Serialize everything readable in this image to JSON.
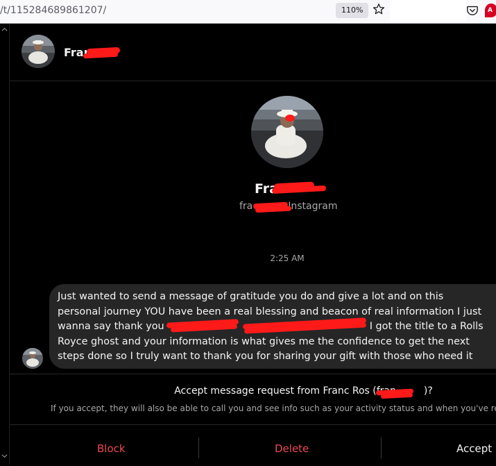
{
  "browser": {
    "url": "/t/115284689861207/",
    "zoom": "110%",
    "icons": [
      "star-icon",
      "pocket-icon",
      "extension-icon"
    ]
  },
  "header": {
    "name": "Fran"
  },
  "profile": {
    "name": "Fra",
    "handle_prefix": "fra",
    "handle_suffix": "Instagram"
  },
  "thread": {
    "timestamp": "2:25 AM",
    "message": {
      "line1": "Just wanted to send a message of gratitude you do and give a lot and on this",
      "line2": "personal journey YOU have been a real blessing and beacon of real information I just",
      "line3_start": "wanna say thank you",
      "line3_end": "I got the title to a Rolls",
      "line4": "Royce ghost and your information is what gives me the confidence to get the next",
      "line5": "steps done so I truly want to thank you for sharing your gift with those who need it"
    }
  },
  "request": {
    "title_start": "Accept message request from Franc Ros (fran",
    "title_end": ")?",
    "description": "If you accept, they will also be able to call you and see info such as your activity status and when you've read r",
    "block_label": "Block",
    "delete_label": "Delete",
    "accept_label": "Accept"
  },
  "colors": {
    "background": "#000000",
    "bubble": "#262626",
    "destructive": "#ed4956",
    "redaction": "#ff1a1a"
  }
}
